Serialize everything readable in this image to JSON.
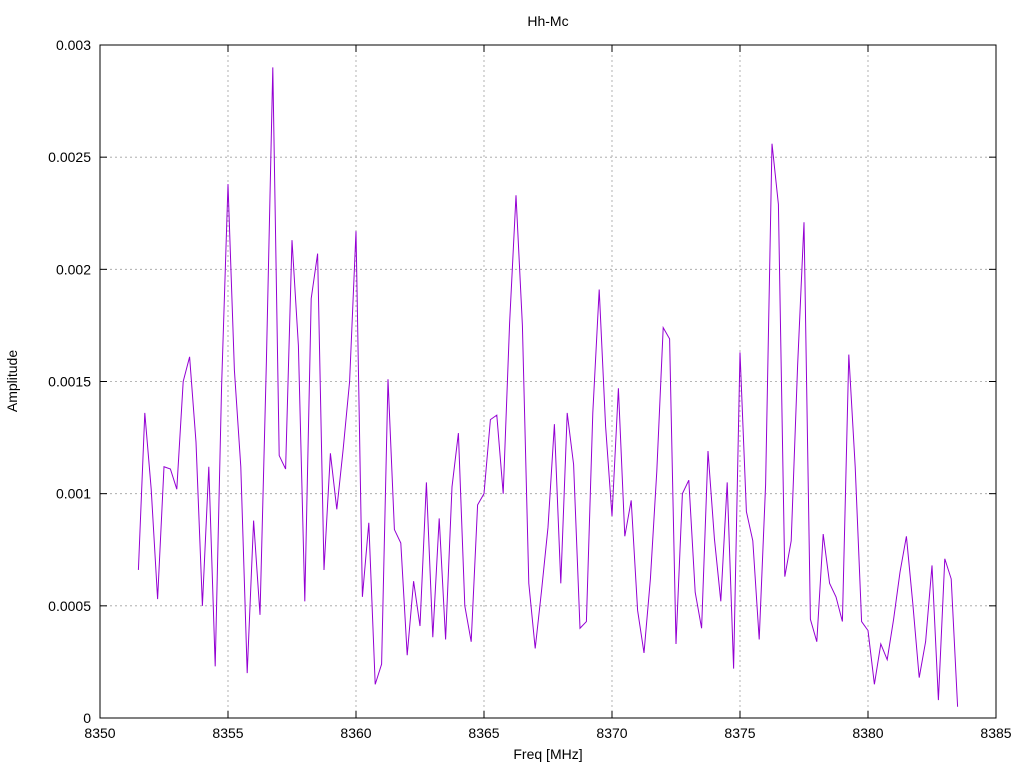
{
  "chart_data": {
    "type": "line",
    "title": "Hh-Mc",
    "xlabel": "Freq [MHz]",
    "ylabel": "Amplitude",
    "xlim": [
      8350,
      8385
    ],
    "ylim": [
      0,
      0.003
    ],
    "xticks": [
      8350,
      8355,
      8360,
      8365,
      8370,
      8375,
      8380,
      8385
    ],
    "yticks": [
      0,
      0.0005,
      0.001,
      0.0015,
      0.002,
      0.0025,
      0.003
    ],
    "xtick_labels": [
      "8350",
      "8355",
      "8360",
      "8365",
      "8370",
      "8375",
      "8380",
      "8385"
    ],
    "ytick_labels": [
      "0",
      "0.0005",
      "0.001",
      "0.0015",
      "0.002",
      "0.0025",
      "0.003"
    ],
    "grid": true,
    "legend": "none",
    "series": [
      {
        "color": "#9400d3",
        "x": [
          8351.5,
          8351.75,
          8352.0,
          8352.25,
          8352.5,
          8352.75,
          8353.0,
          8353.25,
          8353.5,
          8353.75,
          8354.0,
          8354.25,
          8354.5,
          8354.75,
          8355.0,
          8355.25,
          8355.5,
          8355.75,
          8356.0,
          8356.25,
          8356.5,
          8356.75,
          8357.0,
          8357.25,
          8357.5,
          8357.75,
          8358.0,
          8358.25,
          8358.5,
          8358.75,
          8359.0,
          8359.25,
          8359.5,
          8359.75,
          8360.0,
          8360.25,
          8360.5,
          8360.75,
          8361.0,
          8361.25,
          8361.5,
          8361.75,
          8362.0,
          8362.25,
          8362.5,
          8362.75,
          8363.0,
          8363.25,
          8363.5,
          8363.75,
          8364.0,
          8364.25,
          8364.5,
          8364.75,
          8365.0,
          8365.25,
          8365.5,
          8365.75,
          8366.0,
          8366.25,
          8366.5,
          8366.75,
          8367.0,
          8367.25,
          8367.5,
          8367.75,
          8368.0,
          8368.25,
          8368.5,
          8368.75,
          8369.0,
          8369.25,
          8369.5,
          8369.75,
          8370.0,
          8370.25,
          8370.5,
          8370.75,
          8371.0,
          8371.25,
          8371.5,
          8371.75,
          8372.0,
          8372.25,
          8372.5,
          8372.75,
          8373.0,
          8373.25,
          8373.5,
          8373.75,
          8374.0,
          8374.25,
          8374.5,
          8374.75,
          8375.0,
          8375.25,
          8375.5,
          8375.75,
          8376.0,
          8376.25,
          8376.5,
          8376.75,
          8377.0,
          8377.25,
          8377.5,
          8377.75,
          8378.0,
          8378.25,
          8378.5,
          8378.75,
          8379.0,
          8379.25,
          8379.5,
          8379.75,
          8380.0,
          8380.25,
          8380.5,
          8380.75,
          8381.0,
          8381.25,
          8381.5,
          8381.75,
          8382.0,
          8382.25,
          8382.5,
          8382.75,
          8383.0,
          8383.25,
          8383.5
        ],
        "y": [
          0.00066,
          0.00136,
          0.00102,
          0.00053,
          0.00112,
          0.00111,
          0.00102,
          0.0015,
          0.00161,
          0.00123,
          0.0005,
          0.00112,
          0.00023,
          0.00148,
          0.00238,
          0.00155,
          0.00112,
          0.0002,
          0.00088,
          0.00046,
          0.00159,
          0.0029,
          0.00117,
          0.00111,
          0.00213,
          0.00166,
          0.00052,
          0.00187,
          0.00207,
          0.00066,
          0.00118,
          0.00093,
          0.0012,
          0.0015,
          0.00217,
          0.00054,
          0.00087,
          0.00015,
          0.00024,
          0.00151,
          0.00084,
          0.00078,
          0.00028,
          0.00061,
          0.00041,
          0.00105,
          0.00036,
          0.00089,
          0.00035,
          0.00103,
          0.00127,
          0.0005,
          0.00034,
          0.00095,
          0.001,
          0.00133,
          0.00135,
          0.001,
          0.00176,
          0.00233,
          0.00175,
          0.0006,
          0.00031,
          0.00057,
          0.00085,
          0.00131,
          0.0006,
          0.00136,
          0.00113,
          0.0004,
          0.00043,
          0.00136,
          0.00191,
          0.0013,
          0.0009,
          0.00147,
          0.00081,
          0.00097,
          0.00048,
          0.00029,
          0.00062,
          0.0011,
          0.00174,
          0.00169,
          0.00033,
          0.001,
          0.00106,
          0.00056,
          0.0004,
          0.00119,
          0.0008,
          0.00052,
          0.00105,
          0.00022,
          0.00163,
          0.00092,
          0.00079,
          0.00035,
          0.00104,
          0.00256,
          0.00229,
          0.00063,
          0.00079,
          0.00157,
          0.00221,
          0.00044,
          0.00034,
          0.00082,
          0.0006,
          0.00054,
          0.00043,
          0.00162,
          0.00112,
          0.00043,
          0.00039,
          0.00015,
          0.00033,
          0.00026,
          0.00044,
          0.00065,
          0.00081,
          0.00051,
          0.00018,
          0.00034,
          0.00068,
          8e-05,
          0.00071,
          0.00062,
          5e-05
        ]
      }
    ]
  }
}
